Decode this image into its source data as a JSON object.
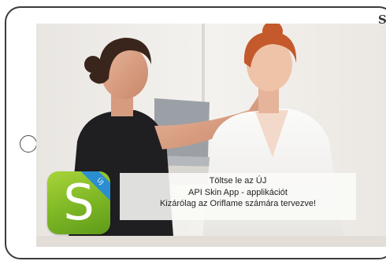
{
  "device": {
    "edge_glyph": "S"
  },
  "banner": {
    "icon_letter": "S",
    "icon_ribbon": "ÚJ",
    "line1": "Töltse le az ÚJ",
    "line2": "API Skin App - applikációt",
    "line3": "Kizárólag az Oriflame számára tervezve!"
  },
  "colors": {
    "app_icon_green": "#7cb624",
    "ribbon_blue": "#2a8ed0",
    "tablet_frame": "#3b3b3b"
  }
}
